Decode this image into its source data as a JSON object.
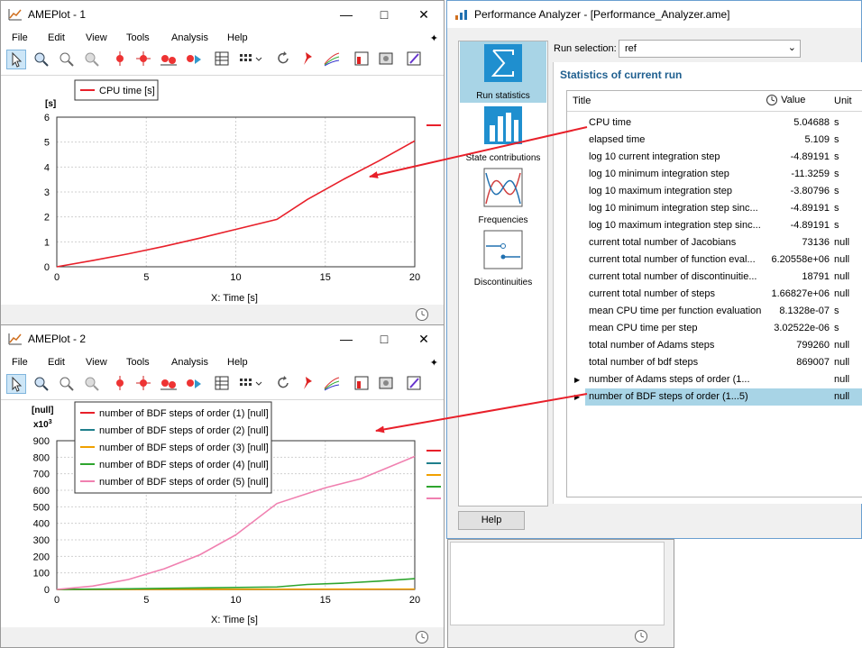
{
  "plot1": {
    "title": "AMEPlot - 1",
    "menu": [
      "File",
      "Edit",
      "View",
      "Tools",
      "Analysis",
      "Help"
    ],
    "legend": [
      "CPU time [s]"
    ],
    "y_unit": "[s]",
    "xlabel": "X: Time [s]"
  },
  "plot2": {
    "title": "AMEPlot - 2",
    "menu": [
      "File",
      "Edit",
      "View",
      "Tools",
      "Analysis",
      "Help"
    ],
    "legend": [
      "number of BDF steps of order (1) [null]",
      "number of BDF steps of order (2) [null]",
      "number of BDF steps of order (3) [null]",
      "number of BDF steps of order (4) [null]",
      "number of BDF steps of order (5) [null]"
    ],
    "y_unit": "[null]",
    "y_scale": "x10",
    "y_scale_exp": "3",
    "xlabel": "X: Time [s]"
  },
  "analyzer": {
    "title": "Performance Analyzer - [Performance_Analyzer.ame]",
    "run_selection_label": "Run selection:",
    "run_selection_value": "ref",
    "section_title": "Statistics of current run",
    "side_items": [
      "Run statistics",
      "State contributions",
      "Frequencies",
      "Discontinuities"
    ],
    "headers": {
      "title": "Title",
      "value": "Value",
      "unit": "Unit"
    },
    "rows": [
      {
        "title": "CPU time",
        "value": "5.04688",
        "unit": "s"
      },
      {
        "title": "elapsed time",
        "value": "5.109",
        "unit": "s"
      },
      {
        "title": "log 10 current integration step",
        "value": "-4.89191",
        "unit": "s"
      },
      {
        "title": "log 10 minimum integration step",
        "value": "-11.3259",
        "unit": "s"
      },
      {
        "title": "log 10 maximum integration step",
        "value": "-3.80796",
        "unit": "s"
      },
      {
        "title": "log 10 minimum integration step sinc...",
        "value": "-4.89191",
        "unit": "s"
      },
      {
        "title": "log 10 maximum integration step sinc...",
        "value": "-4.89191",
        "unit": "s"
      },
      {
        "title": "current total number of Jacobians",
        "value": "73136",
        "unit": "null"
      },
      {
        "title": "current total number of function eval...",
        "value": "6.20558e+06",
        "unit": "null"
      },
      {
        "title": "current total number of discontinuitie...",
        "value": "18791",
        "unit": "null"
      },
      {
        "title": "current total number of steps",
        "value": "1.66827e+06",
        "unit": "null"
      },
      {
        "title": "mean CPU time per function evaluation",
        "value": "8.1328e-07",
        "unit": "s"
      },
      {
        "title": "mean CPU time per step",
        "value": "3.02522e-06",
        "unit": "s"
      },
      {
        "title": "total number of Adams steps",
        "value": "799260",
        "unit": "null"
      },
      {
        "title": "total number of bdf steps",
        "value": "869007",
        "unit": "null"
      },
      {
        "title": "number of Adams steps of order (1...",
        "value": "",
        "unit": "null"
      },
      {
        "title": "number of BDF steps of order (1...5)",
        "value": "",
        "unit": "null"
      }
    ],
    "help_button": "Help"
  },
  "colors": {
    "cpu": "#e8202a",
    "order1": "#e8202a",
    "order2": "#1f7f8c",
    "order3": "#f0a000",
    "order4": "#2ea52e",
    "order5": "#f080b0",
    "selection": "#a8d4e6",
    "accent": "#2070b0"
  },
  "chart_data": [
    {
      "type": "line",
      "series": [
        {
          "name": "CPU time [s]",
          "x": [
            0,
            2,
            4,
            6,
            8,
            10,
            12.3,
            14,
            16,
            18,
            20
          ],
          "y": [
            0,
            0.25,
            0.52,
            0.82,
            1.15,
            1.5,
            1.9,
            2.7,
            3.5,
            4.25,
            5.05
          ]
        }
      ],
      "xlabel": "X: Time [s]",
      "ylabel": "[s]",
      "xlim": [
        0,
        20
      ],
      "ylim": [
        0,
        6
      ],
      "xticks": [
        0,
        5,
        10,
        15,
        20
      ],
      "yticks": [
        0,
        1,
        2,
        3,
        4,
        5,
        6
      ],
      "grid": true,
      "legend": "top-left"
    },
    {
      "type": "line",
      "series": [
        {
          "name": "number of BDF steps of order (1) [null]",
          "x": [
            0,
            20
          ],
          "y": [
            0,
            0
          ]
        },
        {
          "name": "number of BDF steps of order (2) [null]",
          "x": [
            0,
            20
          ],
          "y": [
            0,
            1
          ]
        },
        {
          "name": "number of BDF steps of order (3) [null]",
          "x": [
            0,
            20
          ],
          "y": [
            0,
            2
          ]
        },
        {
          "name": "number of BDF steps of order (4) [null]",
          "x": [
            0,
            4,
            8,
            12.3,
            14,
            16,
            18,
            20
          ],
          "y": [
            0,
            4,
            9,
            15,
            30,
            38,
            50,
            65
          ]
        },
        {
          "name": "number of BDF steps of order (5) [null]",
          "x": [
            0,
            2,
            4,
            6,
            8,
            10,
            12.3,
            14,
            15,
            17,
            20
          ],
          "y": [
            0,
            20,
            60,
            125,
            210,
            330,
            520,
            580,
            615,
            670,
            805
          ]
        }
      ],
      "xlabel": "X: Time [s]",
      "ylabel": "[null]",
      "xlim": [
        0,
        20
      ],
      "ylim": [
        0,
        900
      ],
      "xticks": [
        0,
        5,
        10,
        15,
        20
      ],
      "yticks": [
        0,
        100,
        200,
        300,
        400,
        500,
        600,
        700,
        800,
        900
      ],
      "grid": true,
      "legend": "top-left"
    }
  ]
}
